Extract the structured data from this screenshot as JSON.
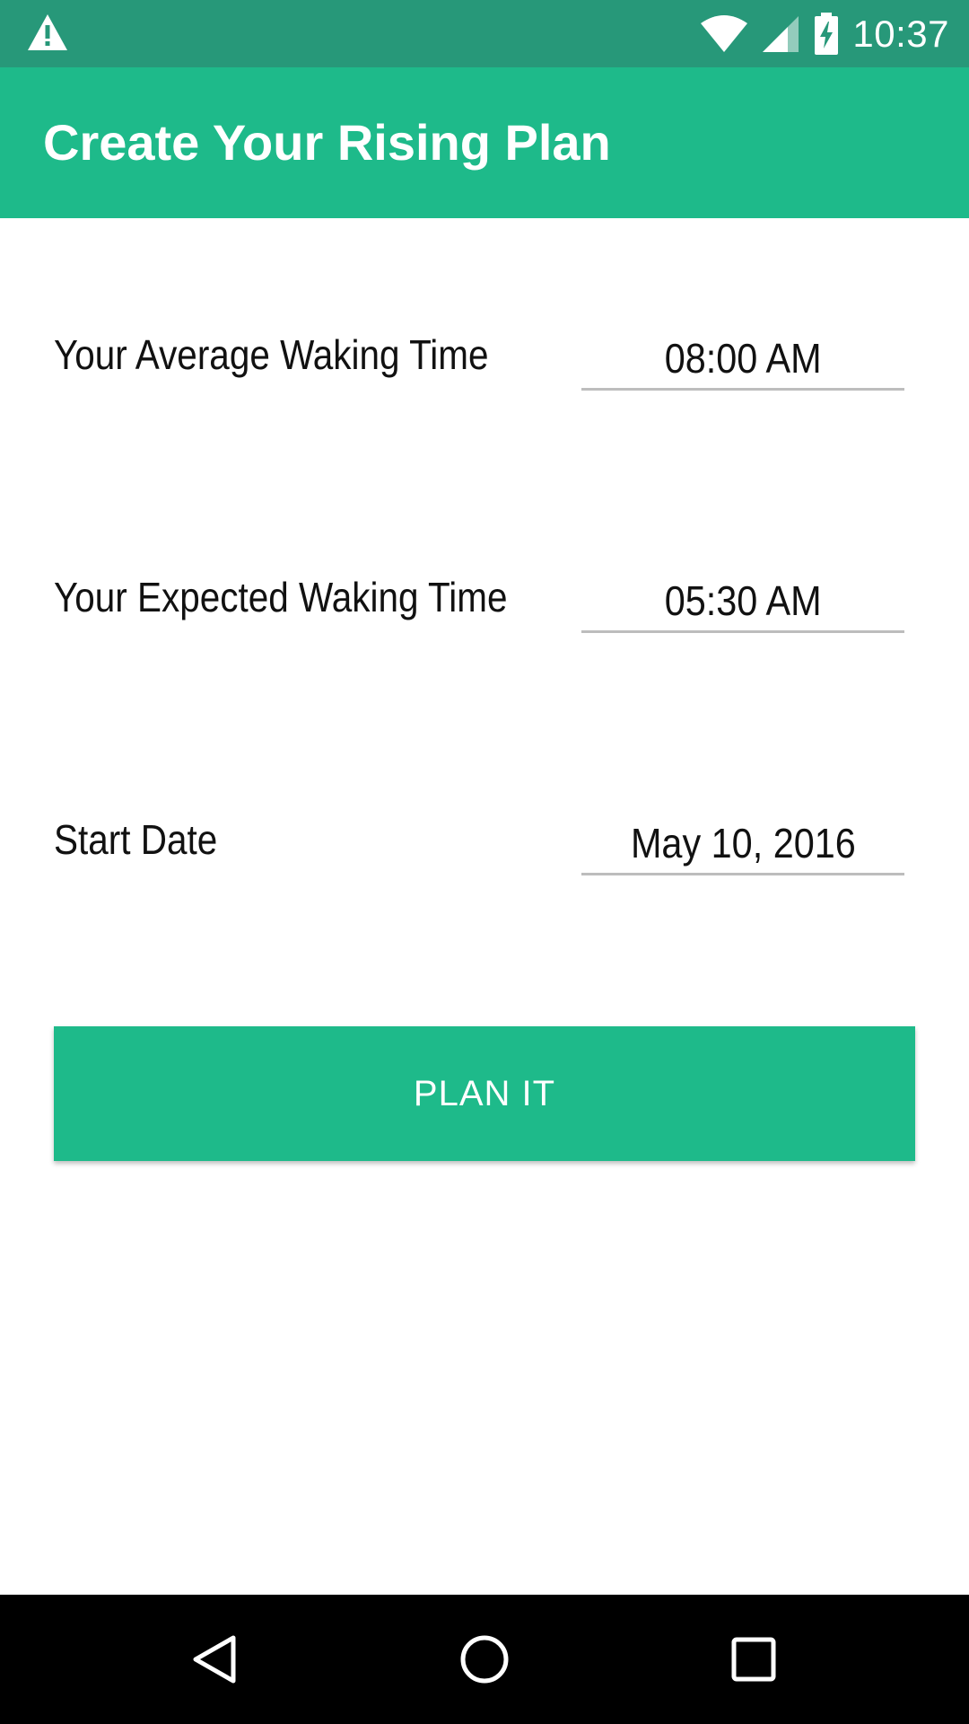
{
  "status_bar": {
    "time": "10:37",
    "icons": [
      "warning-icon",
      "wifi-icon",
      "signal-icon",
      "battery-charging-icon"
    ],
    "color": "#279879"
  },
  "app_bar": {
    "title": "Create Your Rising Plan",
    "color": "#1eba8a"
  },
  "form": {
    "average_waking": {
      "label": "Your Average Waking Time",
      "value": "08:00 AM"
    },
    "expected_waking": {
      "label": "Your Expected Waking Time",
      "value": "05:30 AM"
    },
    "start_date": {
      "label": "Start Date",
      "value": "May 10, 2016"
    }
  },
  "actions": {
    "plan_label": "PLAN IT"
  },
  "nav_bar": {
    "icons": [
      "back-icon",
      "home-icon",
      "recents-icon"
    ]
  }
}
